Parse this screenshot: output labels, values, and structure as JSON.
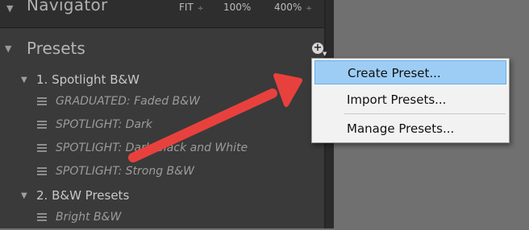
{
  "navigator": {
    "title": "Navigator",
    "zoom_fit": "FIT",
    "zoom_100": "100%",
    "zoom_400": "400%",
    "arrows_glyph": "÷"
  },
  "presets": {
    "title": "Presets",
    "add_button_glyph": "+",
    "folders": [
      {
        "label": "1. Spotlight B&W",
        "items": [
          "GRADUATED: Faded B&W",
          "SPOTLIGHT: Dark",
          "SPOTLIGHT: Dark Black and White",
          "SPOTLIGHT: Strong B&W"
        ]
      },
      {
        "label": "2. B&W Presets",
        "items": [
          "Bright B&W"
        ]
      }
    ]
  },
  "context_menu": {
    "items": [
      "Create Preset...",
      "Import Presets...",
      "Manage Presets..."
    ],
    "highlighted": "Create Preset..."
  },
  "colors": {
    "panel_bg": "#3a3a3a",
    "menu_highlight": "#9dcdf5",
    "annotation_arrow": "#e8413d"
  },
  "icons": {
    "collapse": "triangle-down-icon",
    "preset": "preset-list-icon",
    "add": "plus-circle-icon"
  }
}
